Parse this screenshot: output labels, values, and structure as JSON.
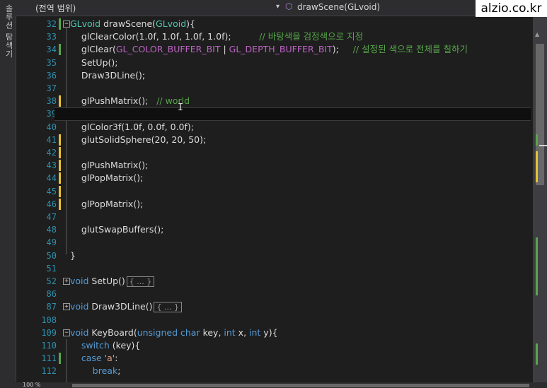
{
  "side_panel": {
    "label": "솔루션 탐색기"
  },
  "navigation": {
    "scope": "(전역 범위)",
    "function": "drawScene(GLvoid)",
    "dropdown_glyph": "▾",
    "function_icon": "⬡"
  },
  "watermark": "alzio.co.kr",
  "split_button": "+",
  "zoom": "100 %",
  "cursor_glyph": "I",
  "icons": {
    "function_icon": "cube-method",
    "fold_expanded": "minus-box",
    "fold_collapsed": "plus-box"
  },
  "colors": {
    "line_number": "#2b91af",
    "keyword": "#569cd6",
    "type": "#4ec9b0",
    "macro": "#bd63c5",
    "comment": "#57a64a",
    "text": "#dcdcdc",
    "saved_change": "#57a64a",
    "unsaved_change": "#e6c235"
  },
  "lines": [
    {
      "num": "32",
      "mark": "g",
      "fold": "⊟",
      "tokens": [
        [
          "t",
          "GLvoid"
        ],
        [
          "p",
          " drawScene("
        ],
        [
          "t",
          "GLvoid"
        ],
        [
          "p",
          "){"
        ]
      ]
    },
    {
      "num": "33",
      "mark": "",
      "fold": "",
      "tokens": [
        [
          "p",
          "    glClearColor(1.0f, 1.0f, 1.0f, 1.0f);          "
        ],
        [
          "c",
          "// 바탕색을 검정색으로 지정"
        ]
      ]
    },
    {
      "num": "34",
      "mark": "g",
      "fold": "",
      "tokens": [
        [
          "p",
          "    glClear("
        ],
        [
          "m",
          "GL_COLOR_BUFFER_BIT"
        ],
        [
          "p",
          " | "
        ],
        [
          "m",
          "GL_DEPTH_BUFFER_BIT"
        ],
        [
          "p",
          ");     "
        ],
        [
          "c",
          "// 설정된 색으로 전체를 칠하기"
        ]
      ]
    },
    {
      "num": "35",
      "mark": "",
      "fold": "",
      "tokens": [
        [
          "p",
          "    SetUp();"
        ]
      ]
    },
    {
      "num": "36",
      "mark": "",
      "fold": "",
      "tokens": [
        [
          "p",
          "    Draw3DLine();"
        ]
      ]
    },
    {
      "num": "37",
      "mark": "",
      "fold": "",
      "tokens": []
    },
    {
      "num": "38",
      "mark": "y",
      "fold": "",
      "tokens": [
        [
          "p",
          "    glPushMatrix();   "
        ],
        [
          "c",
          "// world"
        ]
      ]
    },
    {
      "num": "39",
      "mark": "y",
      "fold": "",
      "tokens": []
    },
    {
      "num": "40",
      "mark": "",
      "fold": "",
      "tokens": [
        [
          "p",
          "    glColor3f(1.0f, 0.0f, 0.0f);"
        ]
      ]
    },
    {
      "num": "41",
      "mark": "y",
      "fold": "",
      "tokens": [
        [
          "p",
          "    glutSolidSphere(20, 20, 50);"
        ]
      ]
    },
    {
      "num": "42",
      "mark": "y",
      "fold": "",
      "tokens": []
    },
    {
      "num": "43",
      "mark": "y",
      "fold": "",
      "tokens": [
        [
          "p",
          "    glPushMatrix();"
        ]
      ]
    },
    {
      "num": "44",
      "mark": "y",
      "fold": "",
      "tokens": [
        [
          "p",
          "    glPopMatrix();"
        ]
      ]
    },
    {
      "num": "45",
      "mark": "y",
      "fold": "",
      "tokens": []
    },
    {
      "num": "46",
      "mark": "y",
      "fold": "",
      "tokens": [
        [
          "p",
          "    glPopMatrix();"
        ]
      ]
    },
    {
      "num": "47",
      "mark": "",
      "fold": "",
      "tokens": []
    },
    {
      "num": "48",
      "mark": "",
      "fold": "",
      "tokens": [
        [
          "p",
          "    glutSwapBuffers();"
        ]
      ]
    },
    {
      "num": "49",
      "mark": "",
      "fold": "",
      "tokens": []
    },
    {
      "num": "50",
      "mark": "",
      "fold": "",
      "tokens": [
        [
          "p",
          "}"
        ]
      ]
    },
    {
      "num": "51",
      "mark": "",
      "fold": "",
      "tokens": []
    },
    {
      "num": "52",
      "mark": "",
      "fold": "⊞",
      "tokens": [
        [
          "k",
          "void"
        ],
        [
          "p",
          " SetUp()"
        ],
        [
          "x",
          "{ ... }"
        ]
      ]
    },
    {
      "num": "86",
      "mark": "",
      "fold": "",
      "tokens": []
    },
    {
      "num": "87",
      "mark": "",
      "fold": "⊞",
      "tokens": [
        [
          "k",
          "void"
        ],
        [
          "p",
          " Draw3DLine()"
        ],
        [
          "x",
          "{ ... }"
        ]
      ]
    },
    {
      "num": "108",
      "mark": "",
      "fold": "",
      "tokens": []
    },
    {
      "num": "109",
      "mark": "",
      "fold": "⊟",
      "tokens": [
        [
          "k",
          "void"
        ],
        [
          "p",
          " KeyBoard("
        ],
        [
          "k",
          "unsigned char"
        ],
        [
          "p",
          " key, "
        ],
        [
          "k",
          "int"
        ],
        [
          "p",
          " x, "
        ],
        [
          "k",
          "int"
        ],
        [
          "p",
          " y){"
        ]
      ]
    },
    {
      "num": "110",
      "mark": "",
      "fold": "",
      "tokens": [
        [
          "p",
          "    "
        ],
        [
          "k",
          "switch"
        ],
        [
          "p",
          " (key){"
        ]
      ]
    },
    {
      "num": "111",
      "mark": "g",
      "fold": "",
      "tokens": [
        [
          "p",
          "    "
        ],
        [
          "k",
          "case"
        ],
        [
          "p",
          " "
        ],
        [
          "s",
          "'a'"
        ],
        [
          "p",
          ":"
        ]
      ]
    },
    {
      "num": "112",
      "mark": "",
      "fold": "",
      "tokens": [
        [
          "p",
          "        "
        ],
        [
          "k",
          "break"
        ],
        [
          "p",
          ";"
        ]
      ]
    }
  ]
}
